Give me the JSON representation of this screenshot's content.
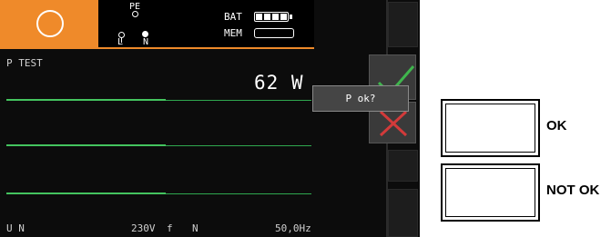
{
  "header": {
    "terminals": {
      "pe": "PE",
      "l": "L",
      "n": "N"
    },
    "bat_label": "BAT",
    "mem_label": "MEM",
    "icon": "circle-icon"
  },
  "main": {
    "mode_title": "P TEST",
    "measurement": "62 W",
    "prompt": "P ok?"
  },
  "footer": {
    "u_label": "U N",
    "u_value": "230V",
    "f_label": "f",
    "f_sub": "N",
    "f_value": "50,0Hz"
  },
  "softkeys": {
    "ok_icon": "checkmark-icon",
    "nok_icon": "cross-icon"
  },
  "legend": {
    "ok_label": "OK",
    "not_ok_label": "NOT OK"
  },
  "colors": {
    "accent": "#ef8a2a",
    "screen_bg": "#0c0c0c",
    "trace": "#2fa84f",
    "check": "#3fb54d",
    "cross": "#d23a3a"
  }
}
